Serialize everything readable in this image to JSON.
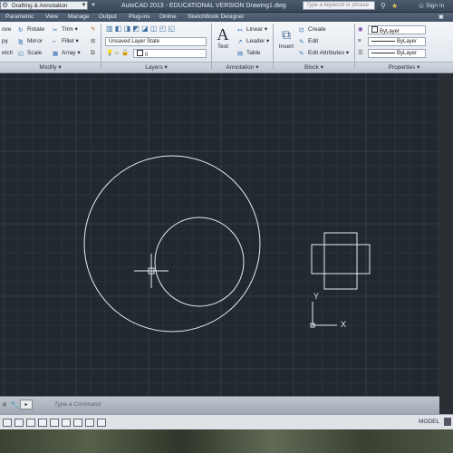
{
  "titlebar": {
    "workspace": "Drafting & Annotation",
    "app_title": "AutoCAD 2013 - EDUCATIONAL VERSION   Drawing1.dwg",
    "search_placeholder": "Type a keyword or phrase",
    "signin": "Sign In"
  },
  "tabs": [
    "Parametric",
    "View",
    "Manage",
    "Output",
    "Plug-ins",
    "Online",
    "SketchBook Designer"
  ],
  "modify": {
    "col1": [
      "ove",
      "py",
      "etch"
    ],
    "col2": [
      "Rotate",
      "Mirror",
      "Scale"
    ],
    "col3": [
      "Trim",
      "Fillet",
      "Array"
    ],
    "title": "Modify"
  },
  "layers": {
    "state": "Unsaved Layer State",
    "current": "0",
    "title": "Layers"
  },
  "annotation": {
    "text": "Text",
    "linear": "Linear",
    "leader": "Leader",
    "table": "Table",
    "title": "Annotation"
  },
  "block": {
    "insert": "Insert",
    "create": "Create",
    "edit": "Edit",
    "edit_attributes": "Edit Attributes",
    "title": "Block"
  },
  "properties": {
    "color": "ByLayer",
    "linetype": "ByLayer",
    "lineweight": "ByLayer",
    "title": "Properties"
  },
  "command": {
    "placeholder": "Type a Command"
  },
  "status": {
    "model": "MODEL"
  },
  "colors": {
    "canvas": "#212830",
    "grid_minor": "#2a323b",
    "grid_major": "#333c46",
    "geometry": "#e8ecef"
  }
}
